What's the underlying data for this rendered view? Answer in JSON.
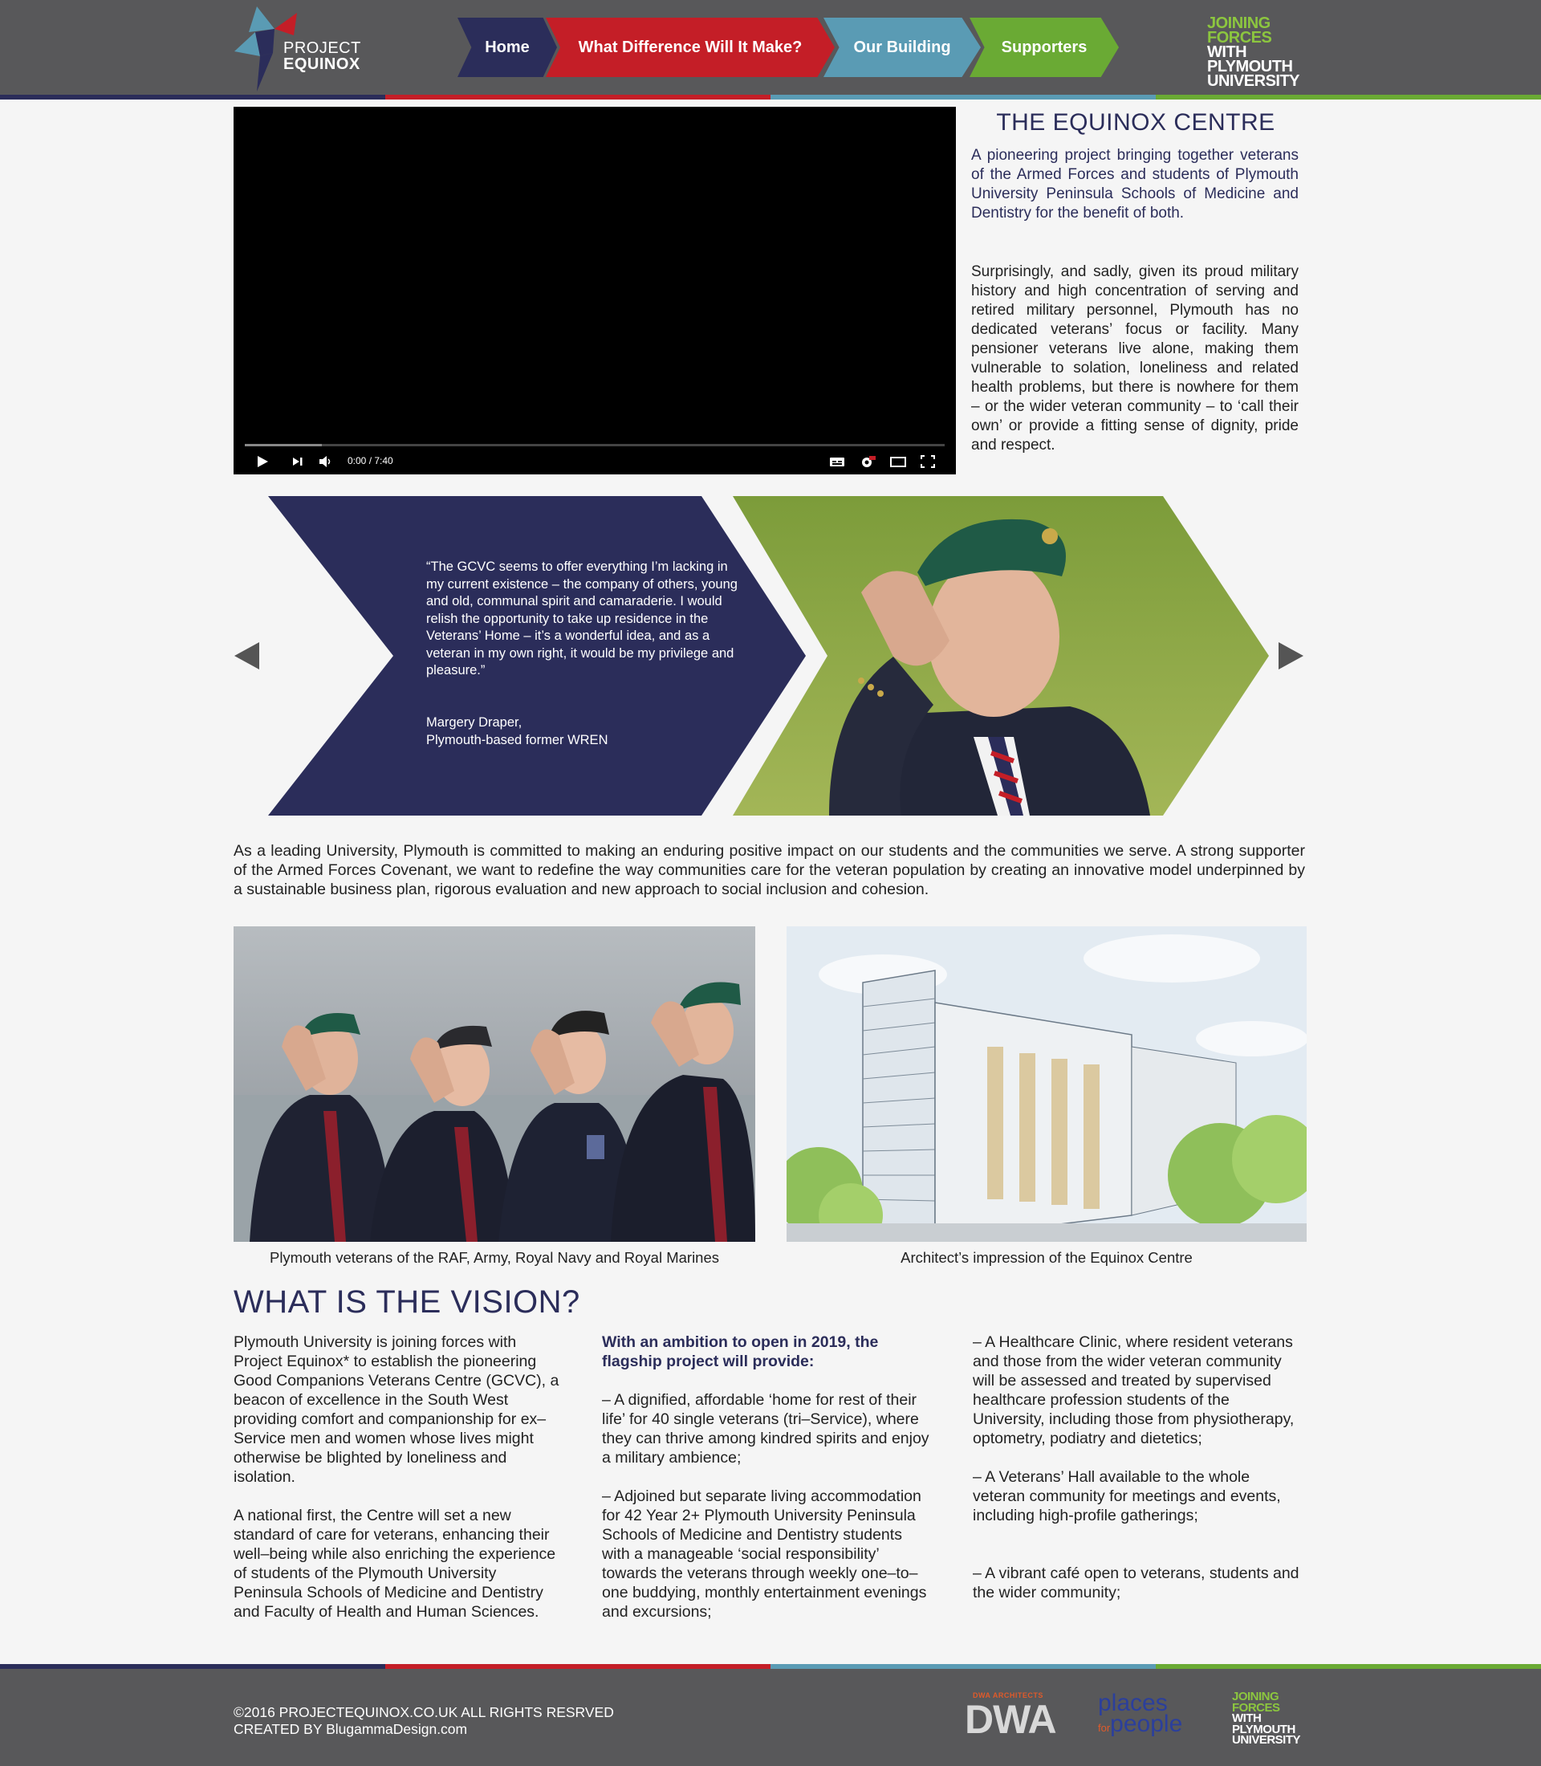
{
  "header": {
    "logo": {
      "line1": "PROJECT",
      "line2": "EQUINOX"
    },
    "nav": [
      {
        "label": "Home",
        "color": "#2b2d5a"
      },
      {
        "label": "What Difference Will It Make?",
        "color": "#c41e27"
      },
      {
        "label": "Our Building",
        "color": "#5a9bb4"
      },
      {
        "label": "Supporters",
        "color": "#6aaa34"
      }
    ],
    "partner": {
      "line1": "JOINING",
      "line2": "FORCES",
      "line3": "WITH",
      "line4": "PLYMOUTH",
      "line5": "UNIVERSITY"
    }
  },
  "video": {
    "time": "0:00 / 7:40",
    "progress": 0.11
  },
  "centre": {
    "title": "THE EQUINOX CENTRE",
    "intro": "A pioneering project bringing together veterans of the Armed Forces and students of Plymouth University Peninsula Schools of Medicine and Dentistry for the benefit of both.",
    "body": "Surprisingly, and sadly, given its proud military history and high concentration of serving and retired military personnel, Plymouth has no dedicated veterans’ focus or facility. Many pensioner veterans live alone, making them vulnerable to solation, loneliness and related health problems, but there is nowhere for them – or the wider veteran community – to ‘call their own’ or provide a fitting sense of dignity, pride and respect."
  },
  "quote": {
    "text": "“The GCVC seems to offer everything I’m lacking in my current existence – the company of others, young and old, communal spirit and camaraderie. I would relish the opportunity to take up residence in the Veterans’ Home – it’s a wonderful idea, and as a veteran in my own right, it would be my privilege and pleasure.”",
    "author": "Margery Draper,",
    "author_role": "Plymouth-based former WREN"
  },
  "lead": "As a leading University, Plymouth is committed to making an enduring positive impact on our students and the communities we serve. A strong supporter of the Armed Forces Covenant, we want to redefine the way communities care for the veteran population by creating an innovative model underpinned by a sustainable business plan, rigorous evaluation and new approach to social inclusion and cohesion.",
  "captions": {
    "photo1": "Plymouth veterans of the RAF, Army, Royal Navy and Royal Marines",
    "photo2": "Architect’s impression of the Equinox Centre"
  },
  "vision": {
    "title": "WHAT IS THE VISION?",
    "col1": [
      "Plymouth University is joining forces with Project Equinox* to establish the pioneering Good Companions Veterans Centre (GCVC), a beacon of excellence in the South West providing comfort and companionship for ex–Service men and women whose lives might otherwise be blighted by loneliness and isolation.",
      "A national first, the Centre will set a new standard of care for veterans, enhancing their well–being while also enriching the experience of students of the Plymouth University Peninsula Schools of Medicine and Dentistry and Faculty of Health and Human Sciences."
    ],
    "col2_lead": "With an ambition to open in 2019, the flagship project will provide:",
    "col2": [
      "–  A dignified, affordable ‘home for rest of their life’ for 40 single veterans (tri–Service), where they can thrive among kindred spirits and enjoy a military ambience;",
      "–  Adjoined but separate living accommodation for 42 Year 2+ Plymouth University Peninsula Schools of Medicine and Dentistry students with a manageable ‘social responsibility’ towards the veterans through weekly one–to–one buddying, monthly entertainment evenings and excursions;"
    ],
    "col3": [
      "– A Healthcare Clinic, where resident veterans and those from the wider veteran community will be assessed and treated by supervised healthcare profession students of the University, including those from physiotherapy, optometry, podiatry and dietetics;",
      "– A Veterans’ Hall available to  the whole veteran community  for meetings and events,  including high-profile gatherings;",
      "– A vibrant café open to veterans, students and the wider community;"
    ]
  },
  "footer": {
    "copyright": "©2016 PROJECTEQUINOX.CO.UK ALL RIGHTS RESRVED",
    "credit": "CREATED BY BlugammaDesign.com",
    "dwa_small": "DWA ARCHITECTS",
    "dwa": "DWA",
    "places_line1": "places",
    "places_for": "for",
    "places_line2": "people",
    "partner": {
      "line1": "JOINING",
      "line2": "FORCES",
      "line3": "WITH",
      "line4": "PLYMOUTH",
      "line5": "UNIVERSITY"
    }
  }
}
